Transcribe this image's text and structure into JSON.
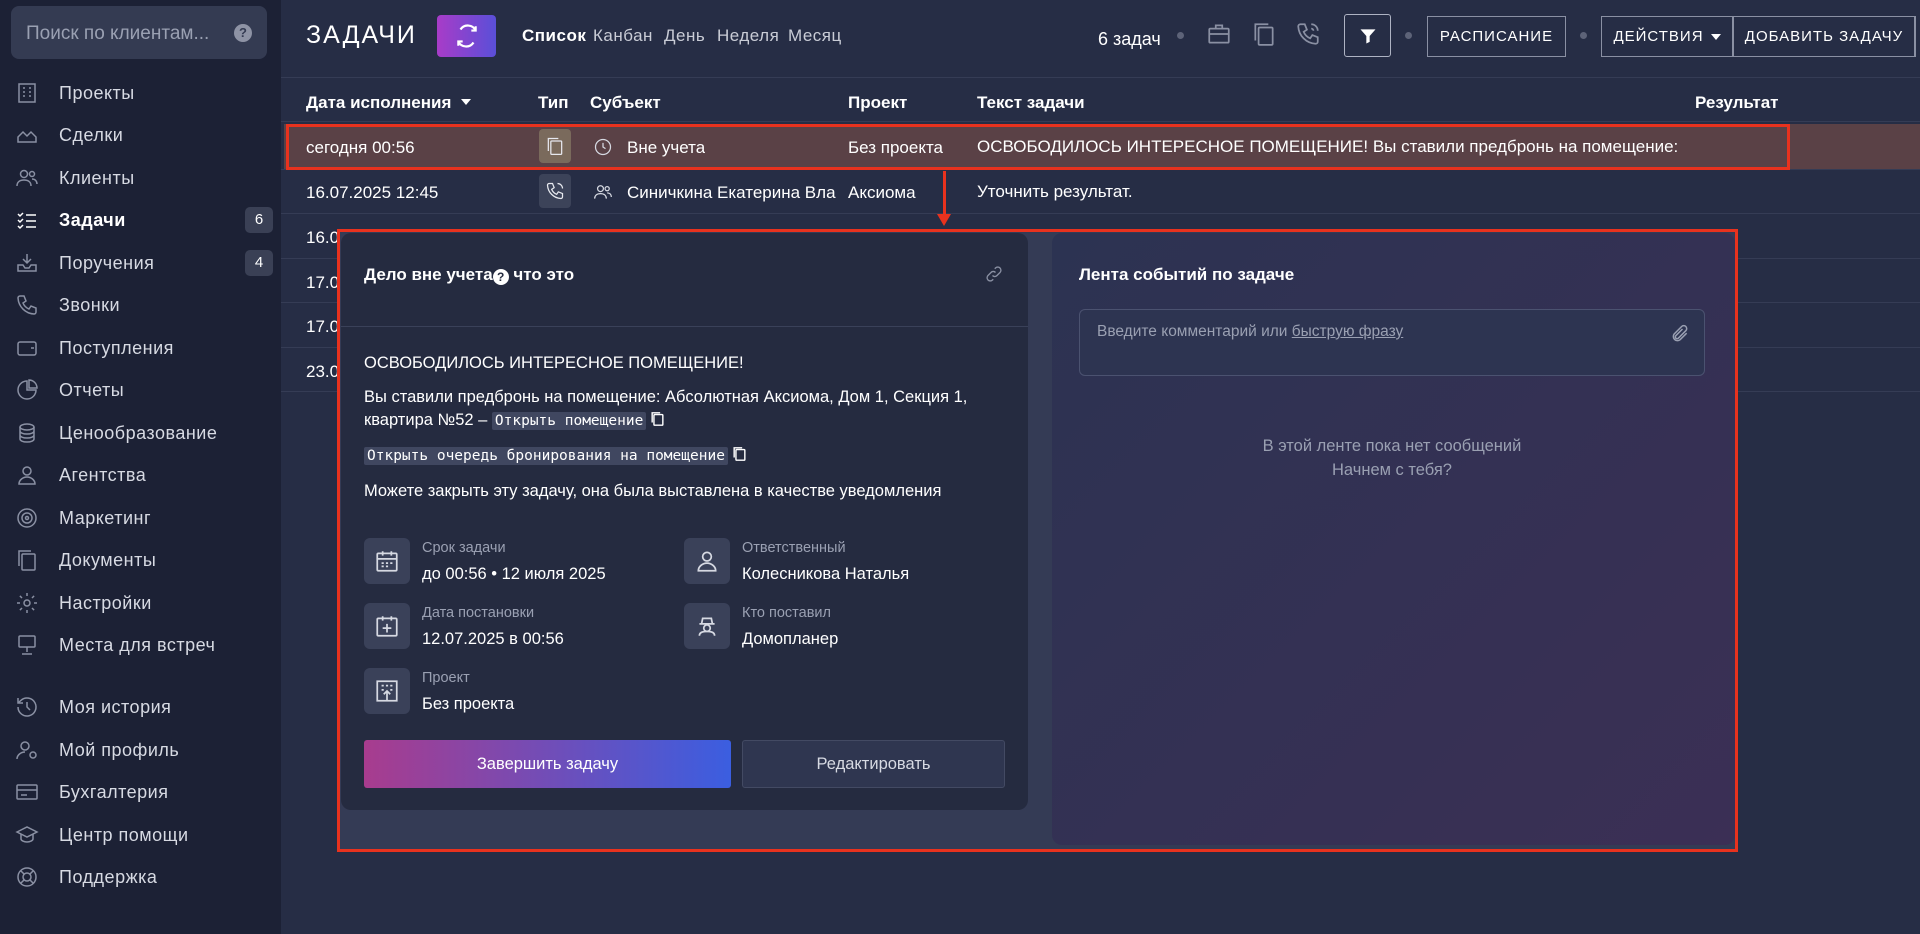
{
  "sidebar": {
    "search_placeholder": "Поиск по клиентам...",
    "items": [
      {
        "label": "Проекты",
        "icon": "building-icon"
      },
      {
        "label": "Сделки",
        "icon": "deals-icon"
      },
      {
        "label": "Клиенты",
        "icon": "users-icon"
      },
      {
        "label": "Задачи",
        "icon": "tasks-icon",
        "badge": "6",
        "active": true
      },
      {
        "label": "Поручения",
        "icon": "inbox-icon",
        "badge": "4"
      },
      {
        "label": "Звонки",
        "icon": "phone-icon"
      },
      {
        "label": "Поступления",
        "icon": "wallet-icon"
      },
      {
        "label": "Отчеты",
        "icon": "pie-chart-icon"
      },
      {
        "label": "Ценообразование",
        "icon": "coins-icon"
      },
      {
        "label": "Агентства",
        "icon": "agent-icon"
      },
      {
        "label": "Маркетинг",
        "icon": "target-icon"
      },
      {
        "label": "Документы",
        "icon": "documents-icon"
      },
      {
        "label": "Настройки",
        "icon": "gear-icon"
      },
      {
        "label": "Места для встреч",
        "icon": "meeting-icon"
      },
      {
        "label": "Моя история",
        "icon": "history-icon"
      },
      {
        "label": "Мой профиль",
        "icon": "profile-icon"
      },
      {
        "label": "Бухгалтерия",
        "icon": "card-icon"
      },
      {
        "label": "Центр помощи",
        "icon": "graduation-icon"
      },
      {
        "label": "Поддержка",
        "icon": "lifebuoy-icon"
      }
    ]
  },
  "header": {
    "title": "ЗАДАЧИ",
    "tabs": [
      "Список",
      "Канбан",
      "День",
      "Неделя",
      "Месяц"
    ],
    "task_count": "6 задач",
    "schedule_btn": "РАСПИСАНИЕ",
    "actions_btn": "ДЕЙСТВИЯ",
    "add_btn": "ДОБАВИТЬ ЗАДАЧУ"
  },
  "table": {
    "headers": [
      "Дата исполнения",
      "Тип",
      "Субъект",
      "Проект",
      "Текст задачи",
      "Результат"
    ],
    "rows": [
      {
        "date": "сегодня 00:56",
        "subject": "Вне учета",
        "project": "Без проекта",
        "text": "ОСВОБОДИЛОСЬ ИНТЕРЕСНОЕ ПОМЕЩЕНИЕ! Вы ставили предбронь на помещение:"
      },
      {
        "date": "16.07.2025 12:45",
        "subject": "Синичкина Екатерина Вла",
        "project": "Аксиома",
        "text": "Уточнить результат."
      },
      {
        "date": "16.0"
      },
      {
        "date": "17.0"
      },
      {
        "date": "17.0"
      },
      {
        "date": "23.0"
      }
    ]
  },
  "modal": {
    "left": {
      "title": "Дело вне учета",
      "title_suffix": " что это",
      "heading": "ОСВОБОДИЛОСЬ ИНТЕРЕСНОЕ ПОМЕЩЕНИЕ!",
      "line1": "Вы ставили предбронь на помещение: Абсолютная Аксиома, Дом 1, Секция 1,",
      "line2": "квартира №52 – ",
      "open_room": "Открыть помещение",
      "open_queue": "Открыть очередь бронирования на помещение",
      "note": "Можете закрыть эту задачу, она была выставлена в качестве уведомления",
      "deadline_label": "Срок задачи",
      "deadline_value": "до 00:56 • 12 июля 2025",
      "responsible_label": "Ответственный",
      "responsible_value": "Колесникова Наталья",
      "created_label": "Дата постановки",
      "created_value": "12.07.2025 в 00:56",
      "author_label": "Кто поставил",
      "author_value": "Домопланер",
      "project_label": "Проект",
      "project_value": "Без проекта",
      "complete_btn": "Завершить задачу",
      "edit_btn": "Редактировать"
    },
    "right": {
      "title": "Лента событий по задаче",
      "comment_placeholder": "Введите комментарий или ",
      "comment_link": "быструю фразу",
      "empty_line1": "В этой ленте пока нет сообщений",
      "empty_line2": "Начнем с тебя?"
    }
  },
  "colors": {
    "accent_red": "#e8321e",
    "primary_gradient_start": "#a83c8e",
    "primary_gradient_end": "#3b5ee0",
    "highlight_row": "#5a4146"
  }
}
